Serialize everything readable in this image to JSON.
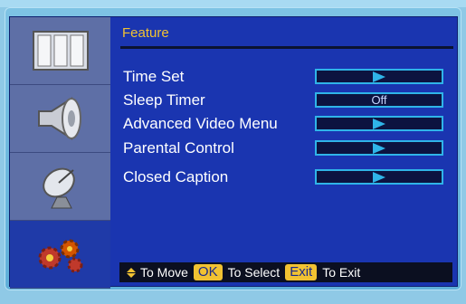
{
  "header": {
    "title": "Feature"
  },
  "sidebar": {
    "items": [
      {
        "icon": "picture-icon"
      },
      {
        "icon": "speaker-icon"
      },
      {
        "icon": "satellite-dish-icon"
      },
      {
        "icon": "gears-icon",
        "active": true
      }
    ]
  },
  "menu": {
    "items": [
      {
        "label": "Time Set",
        "value": ""
      },
      {
        "label": "Sleep Timer",
        "value": "Off"
      },
      {
        "label": "Advanced Video Menu",
        "value": ""
      },
      {
        "label": "Parental Control",
        "value": ""
      },
      {
        "label": "Closed Caption",
        "value": ""
      }
    ]
  },
  "footer": {
    "move_text": "To Move",
    "ok_key": "OK",
    "select_text": "To Select",
    "exit_key": "Exit",
    "exit_text": "To Exit"
  },
  "colors": {
    "accent": "#f1c232",
    "panel": "#1a35b0",
    "value_border": "#2fb4e8"
  }
}
